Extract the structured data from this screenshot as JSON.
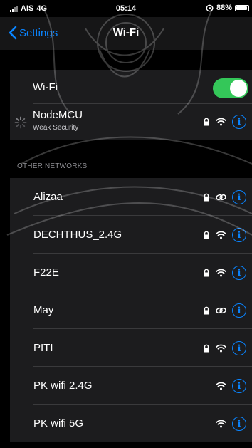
{
  "status_bar": {
    "carrier": "AIS",
    "network": "4G",
    "time": "05:14",
    "battery": "88%"
  },
  "nav": {
    "back_label": "Settings",
    "title": "Wi-Fi"
  },
  "wifi": {
    "label": "Wi-Fi",
    "enabled": true
  },
  "connected": {
    "name": "NodeMCU",
    "security_note": "Weak Security"
  },
  "other_networks": {
    "header": "OTHER NETWORKS",
    "items": [
      {
        "name": "Alizaa",
        "locked": true,
        "icon": "hotspot-link-icon"
      },
      {
        "name": "DECHTHUS_2.4G",
        "locked": true,
        "icon": "wifi-icon"
      },
      {
        "name": "F22E",
        "locked": true,
        "icon": "wifi-icon"
      },
      {
        "name": "May",
        "locked": true,
        "icon": "hotspot-link-icon"
      },
      {
        "name": "PITI",
        "locked": true,
        "icon": "wifi-icon"
      },
      {
        "name": "PK wifi 2.4G",
        "locked": false,
        "icon": "wifi-icon"
      },
      {
        "name": "PK wifi 5G",
        "locked": false,
        "icon": "wifi-icon"
      }
    ]
  },
  "colors": {
    "accent": "#0a84ff",
    "toggle_on": "#34c759",
    "group_bg": "#1c1c1e",
    "screen_bg": "#000000"
  },
  "info_glyph": "i"
}
